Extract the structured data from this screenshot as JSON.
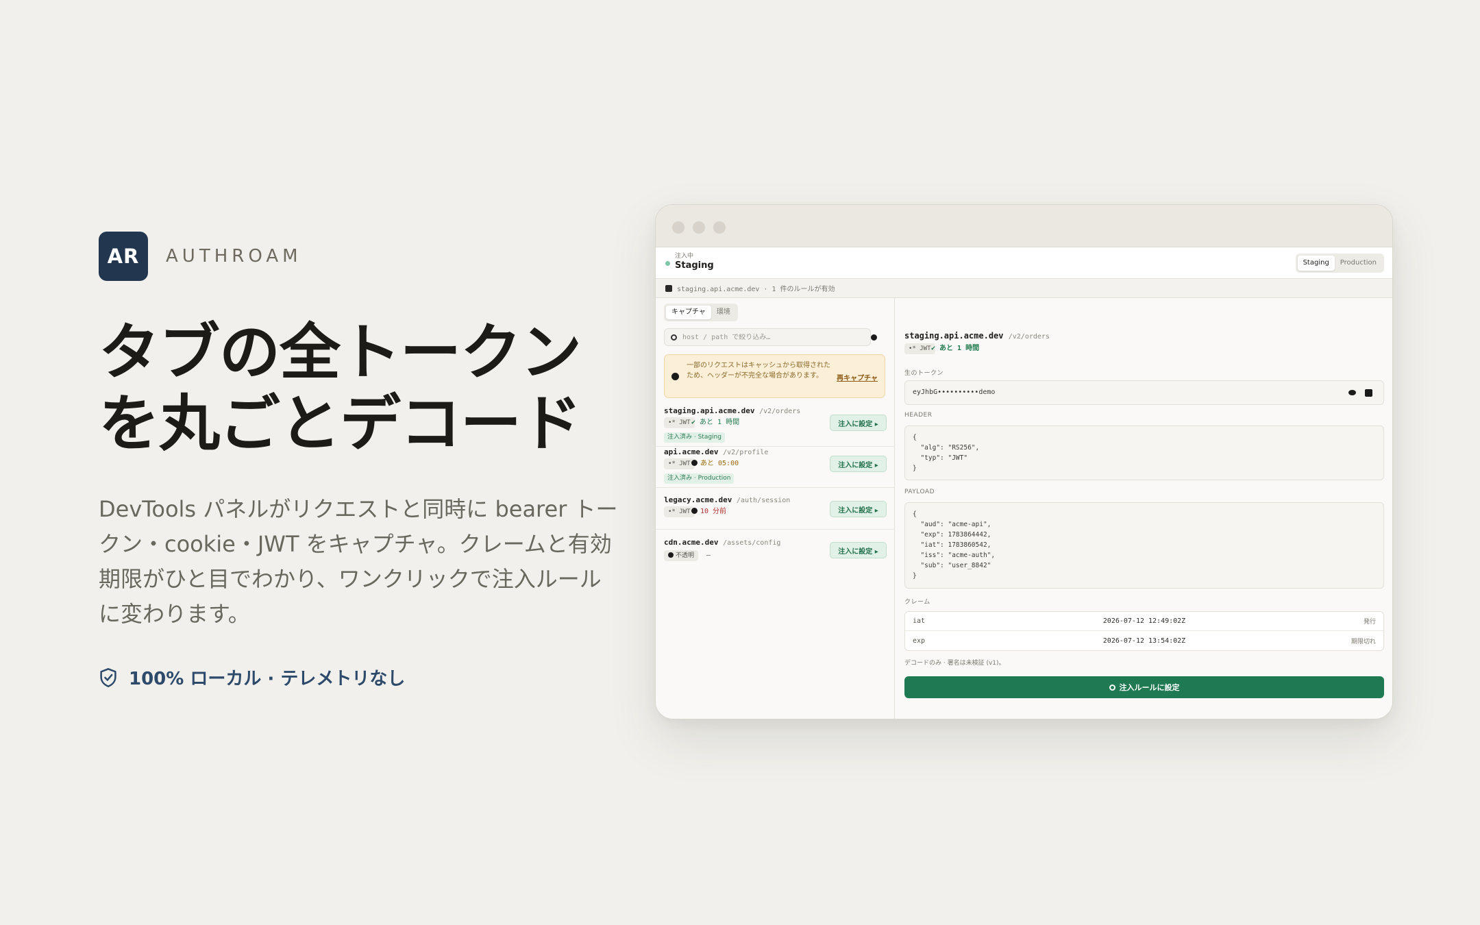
{
  "brand": {
    "logo": "AR",
    "name": "AUTHROAM"
  },
  "hero": {
    "headline_line1": "タブの全トークン",
    "headline_line2": "を丸ごとデコード",
    "lede": "DevTools パネルがリクエストと同時に bearer トークン・cookie・JWT をキャプチャ。クレームと有効期限がひと目でわかり、ワンクリックで注入ルールに変わります。",
    "badge": "100% ローカル · テレメトリなし",
    "badge_icon": "shield-check-icon"
  },
  "ext": {
    "env_sub": "注入中",
    "env_name": "Staging",
    "env_switch": [
      "Staging",
      "Production"
    ],
    "env_active": "Staging",
    "status": "staging.api.acme.dev · 1 件のルールが有効",
    "tabs": [
      "キャプチャ",
      "環境"
    ],
    "search_placeholder": "host / path で絞り込み…",
    "warning": {
      "text": "一部のリクエストはキャッシュから取得されたため、ヘッダーが不完全な場合があります。",
      "link": "再キャプチャ"
    },
    "requests": [
      {
        "host": "staging.api.acme.dev",
        "path": "/v2/orders",
        "chip": "•* JWT",
        "expiry": "✔ あと 1 時間",
        "expiry_color": "#217a4f",
        "tag": "注入済み · Staging",
        "action": "注入に設定 ▸"
      },
      {
        "host": "api.acme.dev",
        "path": "/v2/profile",
        "chip": "•* JWT",
        "expiry": "あと 05:00",
        "expiry_color": "#9a6a10",
        "tag": "注入済み · Production",
        "action": "注入に設定 ▸"
      },
      {
        "host": "legacy.acme.dev",
        "path": "/auth/session",
        "chip": "•* JWT",
        "expiry": "10 分前",
        "expiry_color": "#b42f2f",
        "tag": "",
        "action": "注入に設定 ▸"
      },
      {
        "host": "cdn.acme.dev",
        "path": "/assets/config",
        "chip": "不透明",
        "expiry": "—",
        "expiry_color": "#55524b",
        "tag": "",
        "action": "注入に設定 ▸"
      }
    ],
    "detail": {
      "host": "staging.api.acme.dev",
      "path": "/v2/orders",
      "chip": "•* JWT",
      "expiry": "✔ あと 1 時間",
      "raw_label": "生のトークン",
      "raw_token": "eyJhbG••••••••••demo",
      "header_label": "HEADER",
      "header_json": "{\n  \"alg\": \"RS256\",\n  \"typ\": \"JWT\"\n}",
      "payload_label": "PAYLOAD",
      "payload_json": "{\n  \"aud\": \"acme-api\",\n  \"exp\": 1783864442,\n  \"iat\": 1783860542,\n  \"iss\": \"acme-auth\",\n  \"sub\": \"user_8842\"\n}",
      "claims_label": "クレーム",
      "claims": [
        {
          "key": "iat",
          "value": "2026-07-12 12:49:02Z",
          "note": "発行"
        },
        {
          "key": "exp",
          "value": "2026-07-12 13:54:02Z",
          "note": "期限切れ"
        }
      ],
      "note": "デコードのみ · 署名は未検証 (v1)。",
      "primary_action": "注入ルールに設定"
    }
  }
}
